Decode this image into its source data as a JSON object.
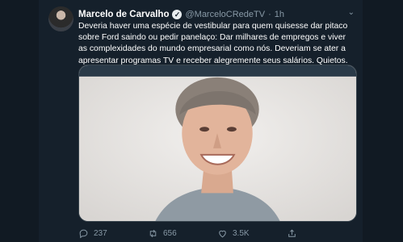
{
  "tweet": {
    "author_name": "Marcelo de Carvalho",
    "handle": "@MarceloCRedeTV",
    "separator": "·",
    "time": "1h",
    "text": "Deveria haver uma espécie de vestibular para quem quisesse dar pitaco sobre Ford saindo ou pedir panelaço: Dar milhares de empregos e viver as complexidades do mundo empresarial como nós. Deveriam se ater a apresentar programas TV e receber alegremente  seus salários. Quietos.",
    "replies": "237",
    "retweets": "656",
    "likes": "3.5K"
  },
  "icons": [
    "verified-badge-icon",
    "caret-down-icon",
    "reply-icon",
    "retweet-icon",
    "like-icon",
    "share-icon"
  ],
  "colors": {
    "background": "#15202b",
    "muted": "#8899a6",
    "text": "#ffffff"
  }
}
